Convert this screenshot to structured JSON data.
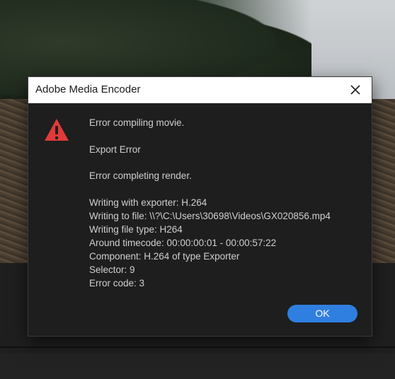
{
  "dialog": {
    "title": "Adobe Media Encoder",
    "close_icon": "close-icon",
    "warning_icon": "warning-icon",
    "line1": "Error compiling movie.",
    "line2": "Export Error",
    "line3": "Error completing render.",
    "details": [
      "Writing with exporter: H.264",
      "Writing to file: \\\\?\\C:\\Users\\30698\\Videos\\GX020856.mp4",
      "Writing file type: H264",
      "Around timecode: 00:00:00:01 - 00:00:57:22",
      "Component: H.264 of type Exporter",
      "Selector: 9",
      "Error code: 3"
    ],
    "ok_label": "OK",
    "accent_color": "#2f7fe0",
    "warning_color": "#e03a3a"
  }
}
